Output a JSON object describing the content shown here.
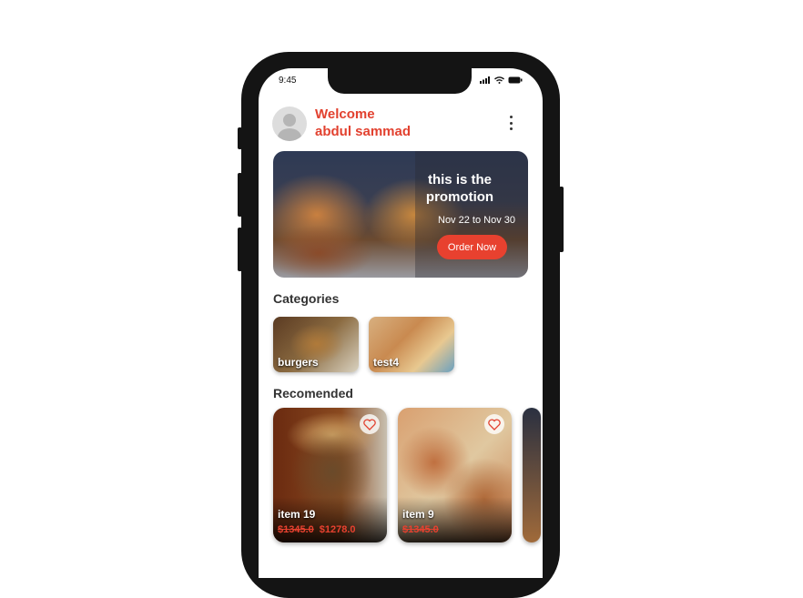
{
  "status_bar": {
    "time": "9:45"
  },
  "header": {
    "greeting": "Welcome",
    "user_name": "abdul sammad"
  },
  "promotion": {
    "title": "this is the promotion",
    "dates": "Nov 22 to Nov 30",
    "button_label": "Order Now"
  },
  "categories": {
    "title": "Categories",
    "items": [
      {
        "label": "burgers"
      },
      {
        "label": "test4"
      }
    ]
  },
  "recommended": {
    "title": "Recomended",
    "items": [
      {
        "name": "item 19",
        "old_price": "$1345.0",
        "price": "$1278.0"
      },
      {
        "name": "item 9",
        "old_price": "$1345.0"
      }
    ]
  },
  "colors": {
    "accent": "#e2412f"
  }
}
